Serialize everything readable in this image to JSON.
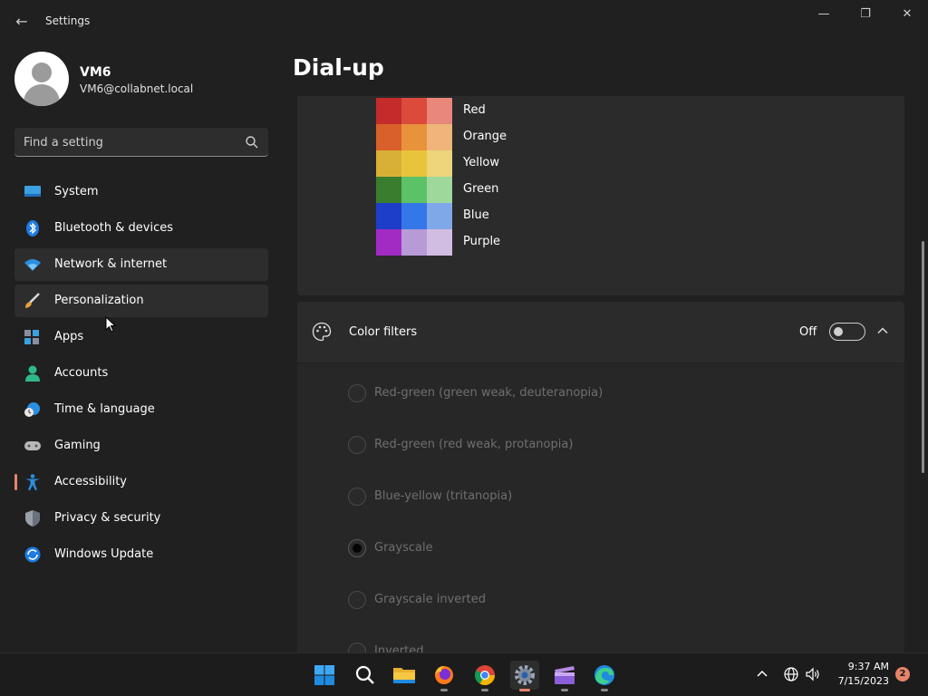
{
  "window": {
    "title": "Settings",
    "back_glyph": "←",
    "minimize_glyph": "—",
    "maximize_glyph": "❐",
    "close_glyph": "✕"
  },
  "profile": {
    "name": "VM6",
    "email": "VM6@collabnet.local"
  },
  "search": {
    "placeholder": "Find a setting",
    "value": ""
  },
  "sidebar": {
    "items": [
      {
        "label": "System",
        "icon": "system-icon"
      },
      {
        "label": "Bluetooth & devices",
        "icon": "bluetooth-icon"
      },
      {
        "label": "Network & internet",
        "icon": "wifi-icon"
      },
      {
        "label": "Personalization",
        "icon": "brush-icon"
      },
      {
        "label": "Apps",
        "icon": "apps-icon"
      },
      {
        "label": "Accounts",
        "icon": "accounts-icon"
      },
      {
        "label": "Time & language",
        "icon": "globe-clock-icon"
      },
      {
        "label": "Gaming",
        "icon": "gamepad-icon"
      },
      {
        "label": "Accessibility",
        "icon": "accessibility-icon"
      },
      {
        "label": "Privacy & security",
        "icon": "shield-icon"
      },
      {
        "label": "Windows Update",
        "icon": "update-icon"
      }
    ],
    "hovered_index": 2,
    "hover_secondary_index": 3,
    "active_index": 8,
    "accent_color": "#e8836b"
  },
  "content": {
    "page_title": "Dial-up",
    "palette": [
      {
        "label": "Red",
        "colors": [
          "#c42b2b",
          "#dc4a3c",
          "#e8877a"
        ]
      },
      {
        "label": "Orange",
        "colors": [
          "#d9602a",
          "#e8923c",
          "#efb57a"
        ]
      },
      {
        "label": "Yellow",
        "colors": [
          "#d9b036",
          "#e8c43c",
          "#ecd57a"
        ]
      },
      {
        "label": "Green",
        "colors": [
          "#3a7d2e",
          "#5cc267",
          "#9ed89a"
        ]
      },
      {
        "label": "Blue",
        "colors": [
          "#1d3ec9",
          "#3477e8",
          "#7ea8e8"
        ]
      },
      {
        "label": "Purple",
        "colors": [
          "#a22bc4",
          "#b89ad6",
          "#d1bde2"
        ]
      }
    ],
    "color_filters": {
      "title": "Color filters",
      "toggle_state": "Off",
      "toggle_on": false,
      "options": [
        {
          "label": "Red-green (green weak, deuteranopia)",
          "checked": false
        },
        {
          "label": "Red-green (red weak, protanopia)",
          "checked": false
        },
        {
          "label": "Blue-yellow (tritanopia)",
          "checked": false
        },
        {
          "label": "Grayscale",
          "checked": true
        },
        {
          "label": "Grayscale inverted",
          "checked": false
        },
        {
          "label": "Inverted",
          "checked": false
        }
      ]
    }
  },
  "taskbar": {
    "apps": [
      {
        "icon": "windows-start-icon",
        "running": false,
        "active": false
      },
      {
        "icon": "search-icon",
        "running": false,
        "active": false
      },
      {
        "icon": "file-explorer-icon",
        "running": false,
        "active": false
      },
      {
        "icon": "firefox-icon",
        "running": true,
        "active": false
      },
      {
        "icon": "chrome-icon",
        "running": true,
        "active": false
      },
      {
        "icon": "settings-gear-icon",
        "running": true,
        "active": true
      },
      {
        "icon": "clipchamp-icon",
        "running": true,
        "active": false
      },
      {
        "icon": "edge-icon",
        "running": true,
        "active": false
      }
    ],
    "tray": [
      "chevron-up-icon",
      "network-globe-icon",
      "volume-icon"
    ],
    "time": "9:37 AM",
    "date": "7/15/2023",
    "notification_count": "2"
  }
}
